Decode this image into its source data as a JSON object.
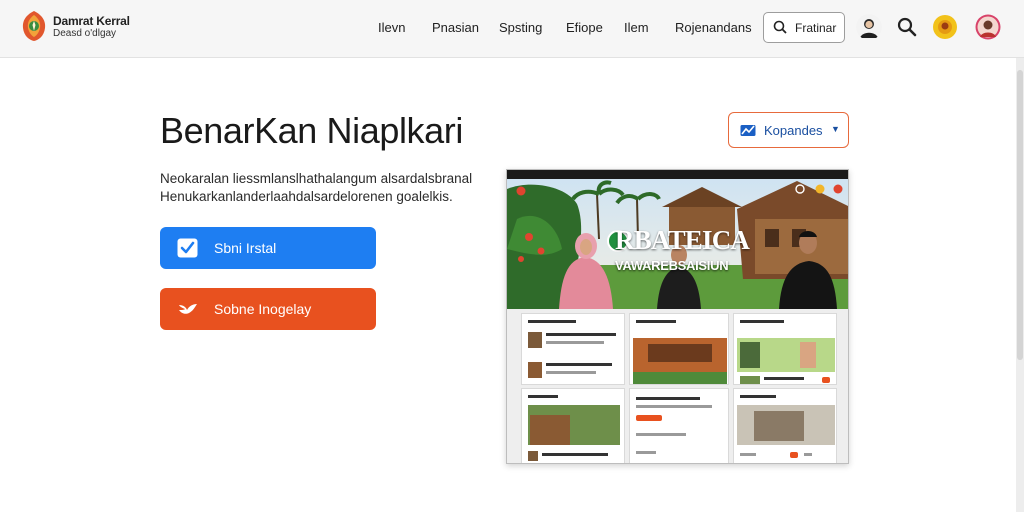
{
  "header": {
    "brand_title": "Damrat Kerral",
    "brand_subtitle": "Deasd o'dlgay",
    "nav": [
      "Ilevn",
      "Pnasian",
      "Spsting",
      "Efiope",
      "Ilem",
      "Rojenandans"
    ],
    "search_label": "Fratinar",
    "icons": [
      "person-avatar-icon",
      "search-icon",
      "profile-badge-icon",
      "user-avatar-icon"
    ]
  },
  "hero": {
    "heading": "BenarKan Niaplkari",
    "description": "Neokaralan liessmlanslhathalangum alsardalsbranal Henukarkanlanderlaahdalsardelorenen goalelkis.",
    "cta_primary": "Sbni Irstal",
    "cta_secondary": "Sobne Inogelay",
    "dropdown_label": "Kopandes"
  },
  "preview": {
    "title": "RBATEICA",
    "subtitle": "VAWAREBSAISIUN"
  },
  "colors": {
    "accent_blue": "#1e7ef2",
    "accent_orange": "#e8511f",
    "dropdown_border": "#e76a3c"
  }
}
